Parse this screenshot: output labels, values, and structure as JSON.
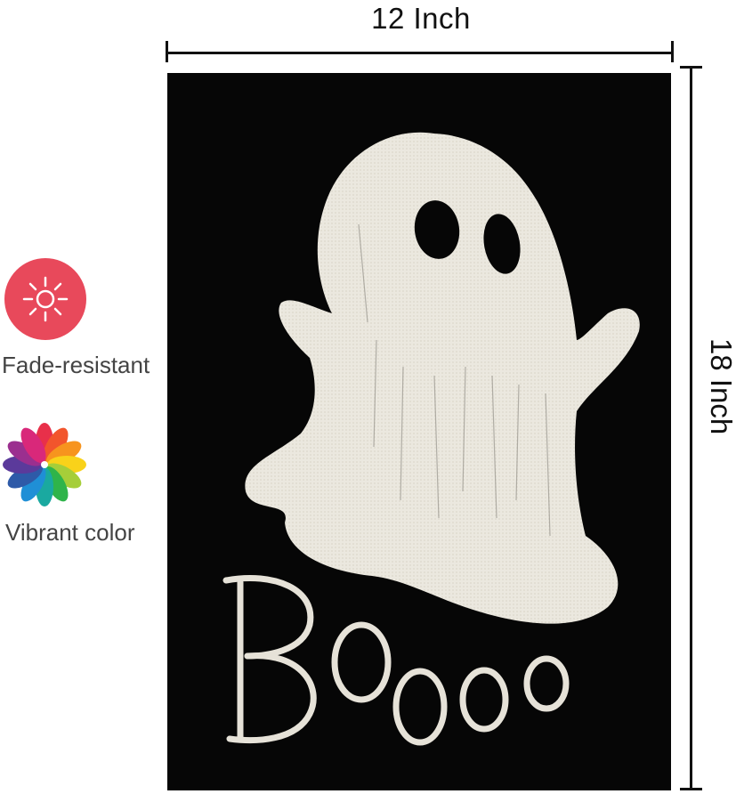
{
  "dimensions": {
    "width_label": "12 Inch",
    "height_label": "18 Inch"
  },
  "features": [
    {
      "icon": "sun-icon",
      "label": "Fade-resistant",
      "color": "#e8495b"
    },
    {
      "icon": "color-wheel-icon",
      "label": "Vibrant color"
    }
  ],
  "flag": {
    "text": "Boooo",
    "background": "#060606",
    "ghost_color": "#eceae2",
    "image": "ghost-illustration"
  }
}
